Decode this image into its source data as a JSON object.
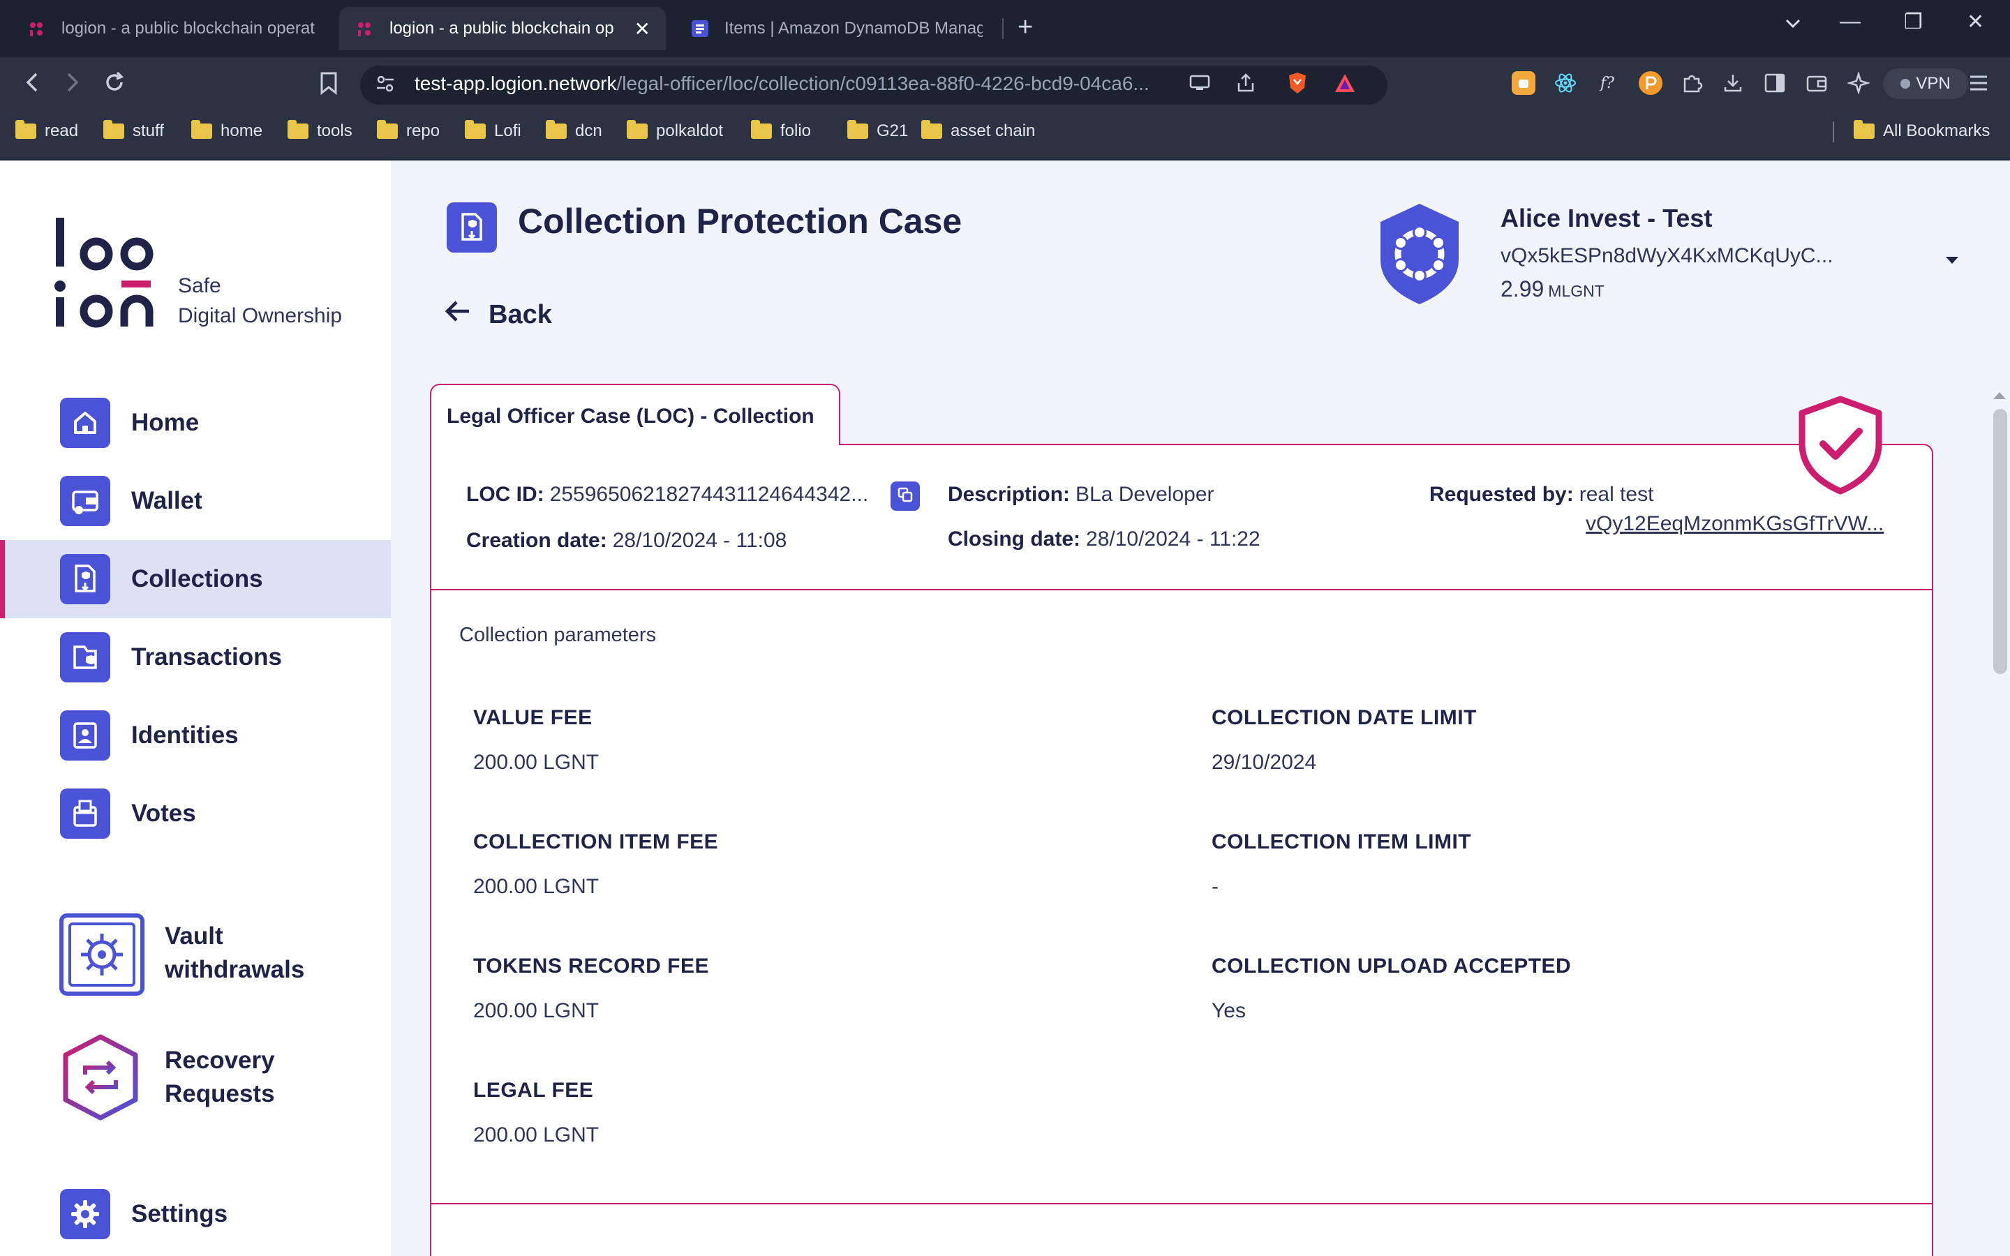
{
  "browser": {
    "tabs": [
      {
        "title": "logion - a public blockchain operat",
        "active": false
      },
      {
        "title": "logion - a public blockchain op",
        "active": true
      },
      {
        "title": "Items | Amazon DynamoDB Manage",
        "active": false
      }
    ],
    "new_tab": "+",
    "window_controls": {
      "minimize": "—",
      "restore": "❐",
      "close": "✕",
      "tab_list": "⌄"
    },
    "url": {
      "host": "test-app.logion.network",
      "path": "/legal-officer/loc/collection/c09113ea-88f0-4226-bcd9-04ca6..."
    },
    "vpn_label": "VPN",
    "bookmarks": [
      "read",
      "stuff",
      "home",
      "tools",
      "repo",
      "Lofi",
      "dcn",
      "polkaldot",
      "folio",
      "G21",
      "asset chain"
    ],
    "all_bookmarks": "All Bookmarks"
  },
  "app": {
    "tagline": [
      "Safe",
      "Digital Ownership"
    ],
    "menu": [
      {
        "label": "Home",
        "icon": "home-icon",
        "active": false
      },
      {
        "label": "Wallet",
        "icon": "wallet-icon",
        "active": false
      },
      {
        "label": "Collections",
        "icon": "collections-icon",
        "active": true
      },
      {
        "label": "Transactions",
        "icon": "transactions-icon",
        "active": false
      },
      {
        "label": "Identities",
        "icon": "identities-icon",
        "active": false
      },
      {
        "label": "Votes",
        "icon": "votes-icon",
        "active": false
      }
    ],
    "menu_secondary": [
      {
        "label_1": "Vault",
        "label_2": "withdrawals",
        "icon": "vault-icon"
      },
      {
        "label_1": "Recovery",
        "label_2": "Requests",
        "icon": "recovery-icon"
      }
    ],
    "settings_label": "Settings",
    "accent_color": "#4a53d6",
    "highlight_color": "#cc1d6e"
  },
  "page": {
    "title": "Collection Protection Case",
    "back_label": "Back",
    "account": {
      "name": "Alice Invest - Test",
      "address": "vQx5kESPn8dWyX4KxMCKqUyC...",
      "balance": "2.99",
      "unit": "MLGNT"
    },
    "loc_tab": "Legal Officer Case (LOC) - Collection",
    "loc_details": {
      "loc_id_label": "LOC ID:",
      "loc_id": "25596506218274431124644342...",
      "creation_date_label": "Creation date:",
      "creation_date": "28/10/2024 - 11:08",
      "description_label": "Description:",
      "description": "BLa Developer",
      "closing_date_label": "Closing date:",
      "closing_date": "28/10/2024 - 11:22",
      "requested_by_label": "Requested by:",
      "requested_by_name": "real test",
      "requested_by_address": "vQy12EeqMzonmKGsGfTrVW..."
    },
    "collection_parameters_title": "Collection parameters",
    "parameters": [
      {
        "label": "VALUE FEE",
        "value": "200.00 LGNT"
      },
      {
        "label": "COLLECTION DATE LIMIT",
        "value": "29/10/2024"
      },
      {
        "label": "COLLECTION ITEM FEE",
        "value": "200.00 LGNT"
      },
      {
        "label": "COLLECTION ITEM LIMIT",
        "value": "-"
      },
      {
        "label": "TOKENS RECORD FEE",
        "value": "200.00 LGNT"
      },
      {
        "label": "COLLECTION UPLOAD ACCEPTED",
        "value": "Yes"
      },
      {
        "label": "LEGAL FEE",
        "value": "200.00 LGNT"
      }
    ]
  }
}
